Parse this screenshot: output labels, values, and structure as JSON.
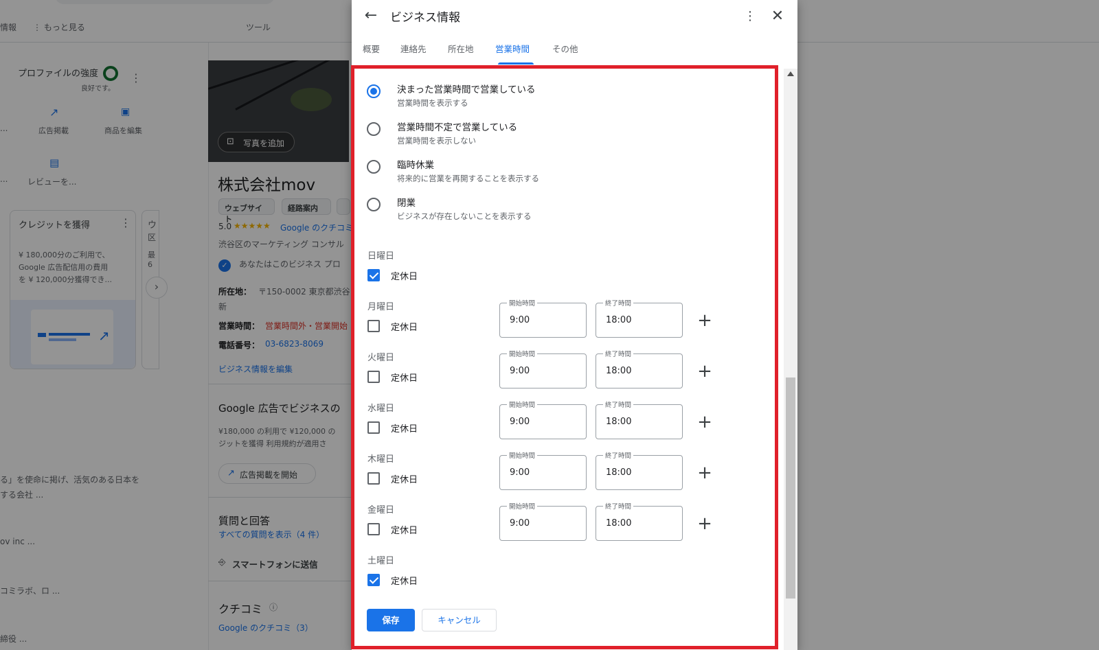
{
  "background": {
    "nav": {
      "left_cut": "情報",
      "more": "⋮ もっと見る",
      "tools": "ツール"
    },
    "left": {
      "strength_title": "プロファイルの強度",
      "strength_sub": "良好です。",
      "action_ads": "広告掲載",
      "action_products": "商品を編集",
      "action_review": "レビューを...",
      "left_cut1": "...",
      "left_cut2": "...",
      "credit_title": "クレジットを獲得",
      "credit_line1": "¥ 180,000分のご利用で、",
      "credit_line2": "Google 広告配信用の費用",
      "credit_line3": "を ¥ 120,000分獲得でき...",
      "card2_line1": "ウ",
      "card2_line2": "区",
      "card2_line3": "最",
      "card2_line4": "6",
      "desc1": "る」を使命に掲げ、活気のある日本を",
      "desc2": "する会社 ...",
      "desc3": "ov inc ...",
      "desc4": "コミラボ、ロ ...",
      "desc5": "締役 ..."
    },
    "center": {
      "add_photo": "写真を追加",
      "business_name": "株式会社mov",
      "chip_website": "ウェブサイト",
      "chip_route": "経路案内",
      "rating": "5.0",
      "stars": "★★★★★",
      "review_link": "Google のクチコミ",
      "category": "渋谷区のマーケティング コンサル",
      "owner_note": "あなたはこのビジネス プロ",
      "address_label": "所在地：",
      "address_value": "〒150-0002 東京都渋谷",
      "address_cont": "新",
      "hours_label": "営業時間：",
      "hours_value": "営業時間外・営業開始",
      "phone_label": "電話番号：",
      "phone_value": "03-6823-8069",
      "edit_link": "ビジネス情報を編集",
      "ads_title": "Google 広告でビジネスの",
      "ads_body1": "¥180,000 の利用で ¥120,000 の",
      "ads_body2": "ジットを獲得 利用規約が適用さ",
      "ads_button": "広告掲載を開始",
      "qa_title": "質問と回答",
      "qa_link": "すべての質問を表示（4 件）",
      "send_phone": "スマートフォンに送信",
      "reviews_title": "クチコミ",
      "reviews_link": "Google のクチコミ（3）"
    }
  },
  "dialog": {
    "title": "ビジネス情報",
    "tabs": [
      "概要",
      "連絡先",
      "所在地",
      "営業時間",
      "その他"
    ],
    "active_tab": "営業時間",
    "options": [
      {
        "title": "決まった営業時間で営業している",
        "sub": "営業時間を表示する",
        "selected": true
      },
      {
        "title": "営業時間不定で営業している",
        "sub": "営業時間を表示しない",
        "selected": false
      },
      {
        "title": "臨時休業",
        "sub": "将来的に営業を再開することを表示する",
        "selected": false
      },
      {
        "title": "閉業",
        "sub": "ビジネスが存在しないことを表示する",
        "selected": false
      }
    ],
    "closed_label": "定休日",
    "open_label": "開始時間",
    "close_label": "終了時間",
    "days": [
      {
        "name": "日曜日",
        "closed": true
      },
      {
        "name": "月曜日",
        "closed": false,
        "open": "9:00",
        "close": "18:00"
      },
      {
        "name": "火曜日",
        "closed": false,
        "open": "9:00",
        "close": "18:00"
      },
      {
        "name": "水曜日",
        "closed": false,
        "open": "9:00",
        "close": "18:00"
      },
      {
        "name": "木曜日",
        "closed": false,
        "open": "9:00",
        "close": "18:00"
      },
      {
        "name": "金曜日",
        "closed": false,
        "open": "9:00",
        "close": "18:00"
      },
      {
        "name": "土曜日",
        "closed": true
      }
    ],
    "save_label": "保存",
    "cancel_label": "キャンセル"
  },
  "colors": {
    "accent": "#1a73e8",
    "highlight": "#e0202a",
    "closed_hours": "#d93025"
  }
}
